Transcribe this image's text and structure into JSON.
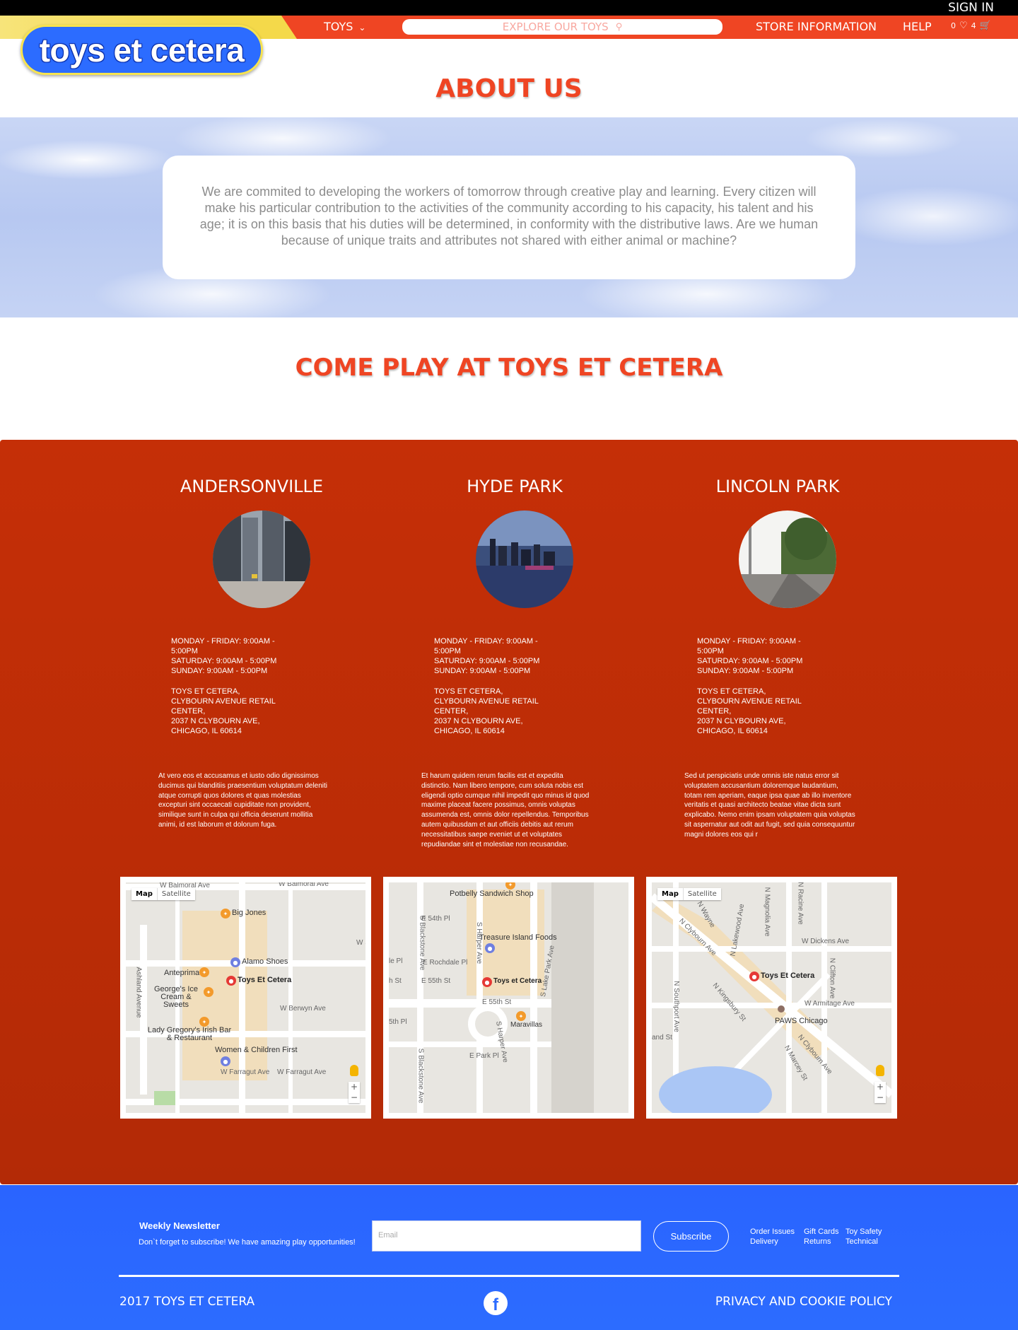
{
  "header": {
    "sign_in": "SIGN IN",
    "logo": "toys et cetera",
    "nav_toys": "TOYS",
    "search_placeholder": "EXPLORE OUR TOYS",
    "nav_store": "STORE INFORMATION",
    "nav_help": "HELP",
    "wishlist_count": "0",
    "cart_count": "4"
  },
  "about": {
    "title": "ABOUT US",
    "text": "We are commited to developing the workers of tomorrow through creative play and learning.  Every citizen will make his particular contribution to the activities of the community according to his capacity, his talent and his age; it is on this basis that his duties will be determined, in conformity with the distributive laws. Are we human because of unique traits and attributes not shared with either animal or machine?"
  },
  "locations_title": "COME PLAY AT TOYS ET CETERA",
  "stores": [
    {
      "name": "ANDERSONVILLE",
      "hours": [
        "MONDAY - FRIDAY: 9:00AM - 5:00PM",
        "SATURDAY: 9:00AM - 5:00PM",
        "SUNDAY: 9:00AM - 5:00PM"
      ],
      "address": [
        "TOYS ET CETERA,",
        "CLYBOURN AVENUE RETAIL CENTER,",
        "2037 N CLYBOURN AVE,",
        "CHICAGO, IL 60614"
      ],
      "description": "At vero eos et accusamus et iusto odio dignissimos ducimus qui blanditiis praesentium voluptatum deleniti atque corrupti quos dolores et quas molestias excepturi sint occaecati cupiditate non provident, similique sunt in culpa qui officia deserunt mollitia animi, id est laborum et dolorum fuga.",
      "map": {
        "tab_map": "Map",
        "tab_satellite": "Satellite",
        "pins": [
          "Big Jones",
          "Alamo Shoes",
          "Toys Et Cetera",
          "Anteprima",
          "George's Ice Cream & Sweets",
          "Lady Gregory's Irish Bar & Restaurant",
          "Women & Children First"
        ],
        "streets": [
          "W Balmoral Ave",
          "W Balmoral Ave",
          "Ashland Avenue",
          "W Berwyn Ave",
          "W Farragut Ave",
          "W Farragut Ave",
          "W S"
        ]
      }
    },
    {
      "name": "HYDE PARK",
      "hours": [
        "MONDAY - FRIDAY: 9:00AM - 5:00PM",
        "SATURDAY: 9:00AM - 5:00PM",
        "SUNDAY: 9:00AM - 5:00PM"
      ],
      "address": [
        "TOYS ET CETERA,",
        "CLYBOURN AVENUE RETAIL CENTER,",
        "2037 N CLYBOURN AVE,",
        "CHICAGO, IL 60614"
      ],
      "description": "Et harum quidem rerum facilis est et expedita distinctio. Nam libero tempore, cum soluta nobis est eligendi optio cumque nihil impedit quo minus id quod maxime placeat facere possimus, omnis voluptas assumenda est, omnis dolor repellendus. Temporibus autem quibusdam et aut officiis debitis aut rerum necessitatibus saepe eveniet ut et voluptates repudiandae sint et molestiae non recusandae.",
      "map": {
        "pins": [
          "Potbelly Sandwich Shop",
          "Treasure Island Foods",
          "Toys et Cetera",
          "Maravillas"
        ],
        "streets": [
          "E 54th Pl",
          "E Rochdale Pl",
          "E 55th St",
          "E 55th St",
          "S Blackstone Ave",
          "S Harper Ave",
          "S Lake Park Ave",
          "S Harper Ave",
          "S Blackstone Ave",
          "E Park Pl",
          "5th Pl",
          "h St",
          "le Pl"
        ]
      }
    },
    {
      "name": "LINCOLN PARK",
      "hours": [
        "MONDAY - FRIDAY: 9:00AM - 5:00PM",
        "SATURDAY: 9:00AM - 5:00PM",
        "SUNDAY: 9:00AM - 5:00PM"
      ],
      "address": [
        "TOYS ET CETERA,",
        "CLYBOURN AVENUE RETAIL CENTER,",
        "2037 N CLYBOURN AVE,",
        "CHICAGO, IL 60614"
      ],
      "description": "Sed ut perspiciatis unde omnis iste natus error sit voluptatem accusantium doloremque laudantium, totam rem aperiam, eaque ipsa quae ab illo inventore veritatis et quasi architecto beatae vitae dicta sunt explicabo. Nemo enim ipsam voluptatem quia voluptas sit aspernatur aut odit aut fugit, sed quia consequuntur magni dolores eos qui r",
      "map": {
        "tab_map": "Map",
        "tab_satellite": "Satellite",
        "pins": [
          "Toys Et Cetera",
          "PAWS Chicago"
        ],
        "streets": [
          "N Clybourn Ave",
          "N Lakewood Ave",
          "N Magnolia Ave",
          "N Racine Ave",
          "W Dickens Ave",
          "N Clifton Ave",
          "W Armitage Ave",
          "N Southport Ave",
          "N Kingsbury St",
          "N Clybourn Ave",
          "N Marcey St",
          "and St",
          "N Wayne"
        ]
      }
    }
  ],
  "footer": {
    "newsletter_title": "Weekly Newsletter",
    "newsletter_sub": "Don`t forget to subscribe! We have amazing play opportunities!",
    "email_placeholder": "Email",
    "subscribe": "Subscribe",
    "links_col1": [
      "Order Issues",
      "Delivery"
    ],
    "links_col2": [
      "Gift Cards",
      "Returns"
    ],
    "links_col3": [
      "Toy Safety",
      "Technical"
    ],
    "copyright": "2017 TOYS ET CETERA",
    "facebook": "f",
    "privacy": "PRIVACY AND COOKIE POLICY"
  },
  "colors": {
    "brand_red": "#ef4523",
    "brand_blue": "#2c6cff",
    "logo_border": "#f7e34f",
    "store_bg": "#c52f07"
  }
}
